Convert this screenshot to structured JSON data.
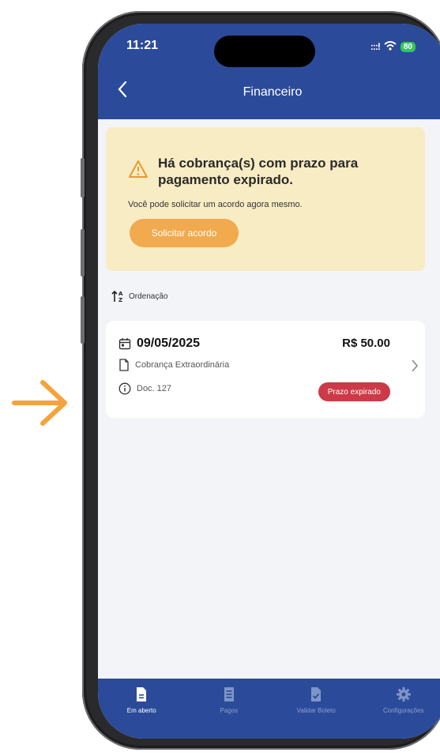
{
  "colors": {
    "header": "#2b4b9a",
    "alert_bg": "#f8ecc4",
    "accent": "#f1aa4e",
    "badge": "#cc3a47",
    "arrow": "#f5a33a"
  },
  "status_bar": {
    "time": "11:21",
    "signal": ":::!",
    "battery": "80"
  },
  "header": {
    "back_icon": "chevron-left-icon",
    "title": "Financeiro"
  },
  "alert": {
    "icon": "warning-triangle-icon",
    "title": "Há cobrança(s) com prazo para pagamento expirado.",
    "text": "Você pode solicitar um acordo agora mesmo.",
    "button_label": "Solicitar acordo"
  },
  "sort": {
    "icon": "sort-az-icon",
    "label": "Ordenação"
  },
  "billing": {
    "date": "09/05/2025",
    "amount": "R$ 50.00",
    "type": "Cobrança Extraordinária",
    "doc": "Doc. 127",
    "status": "Prazo expirado"
  },
  "tabs": [
    {
      "label": "Em aberto",
      "icon": "document-icon",
      "active": true
    },
    {
      "label": "Pagos",
      "icon": "receipt-icon",
      "active": false
    },
    {
      "label": "Validar Boleto",
      "icon": "document-check-icon",
      "active": false
    },
    {
      "label": "Configurações",
      "icon": "gear-icon",
      "active": false
    }
  ]
}
